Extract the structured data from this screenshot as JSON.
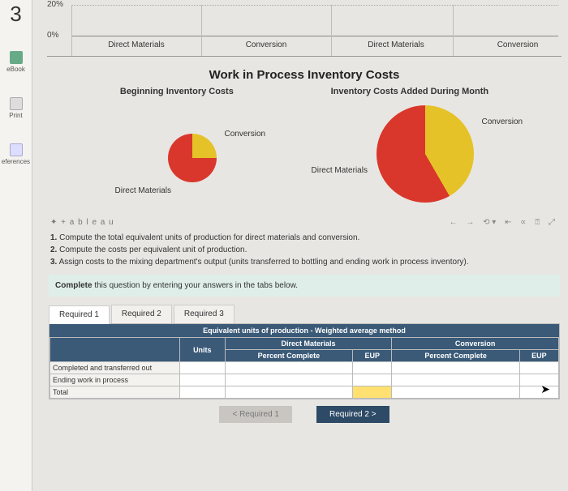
{
  "question_number": "3",
  "sidebar": {
    "ebook": "eBook",
    "print": "Print",
    "references": "eferences"
  },
  "barchart": {
    "yticks": [
      "20%",
      "0%"
    ],
    "xlabels": [
      "Direct Materials",
      "Conversion",
      "Direct Materials",
      "Conversion"
    ]
  },
  "section_title": "Work in Process Inventory Costs",
  "subheads": {
    "left": "Beginning Inventory Costs",
    "right": "Inventory Costs Added During Month"
  },
  "pielabels": {
    "conv": "Conversion",
    "dm": "Direct Materials"
  },
  "tableau_brand": "✦ + a b l e a u",
  "toolbar_icons": [
    "←",
    "→",
    "⟲ ▾",
    "⇤",
    "∝",
    "⍰",
    "⤢"
  ],
  "instructions": {
    "l1_b": "1.",
    "l1": " Compute the total equivalent units of production for direct materials and conversion.",
    "l2_b": "2.",
    "l2": " Compute the costs per equivalent unit of production.",
    "l3_b": "3.",
    "l3": " Assign costs to the mixing department's output (units transferred to bottling and ending work in process inventory)."
  },
  "complete_msg_b": "Complete",
  "complete_msg": " this question by entering your answers in the tabs below.",
  "tabs": [
    "Required 1",
    "Required 2",
    "Required 3"
  ],
  "table": {
    "title": "Equivalent units of production - Weighted average method",
    "group_units": "Units",
    "group_dm": "Direct Materials",
    "group_conv": "Conversion",
    "col_pc": "Percent Complete",
    "col_eup": "EUP",
    "rows": [
      "Completed and transferred out",
      "Ending work in process",
      "Total"
    ]
  },
  "nav": {
    "prev": "<  Required 1",
    "next": "Required 2  >"
  },
  "chart_data": [
    {
      "type": "bar",
      "description": "top cropped bar chart — no bars visibly rise above baseline in crop",
      "categories": [
        "Direct Materials",
        "Conversion",
        "Direct Materials",
        "Conversion"
      ],
      "values": [
        null,
        null,
        null,
        null
      ],
      "ylabel": "",
      "yticks_visible": [
        "20%",
        "0%"
      ]
    },
    {
      "type": "pie",
      "title": "Beginning Inventory Costs",
      "series": [
        {
          "name": "Direct Materials",
          "value": 75,
          "color": "#d9372b"
        },
        {
          "name": "Conversion",
          "value": 25,
          "color": "#e6c229"
        }
      ],
      "note": "values are approximate proportions read from slice angles"
    },
    {
      "type": "pie",
      "title": "Inventory Costs Added During Month",
      "series": [
        {
          "name": "Direct Materials",
          "value": 64,
          "color": "#d9372b"
        },
        {
          "name": "Conversion",
          "value": 36,
          "color": "#e6c229"
        }
      ],
      "note": "values are approximate proportions read from slice angles"
    }
  ]
}
